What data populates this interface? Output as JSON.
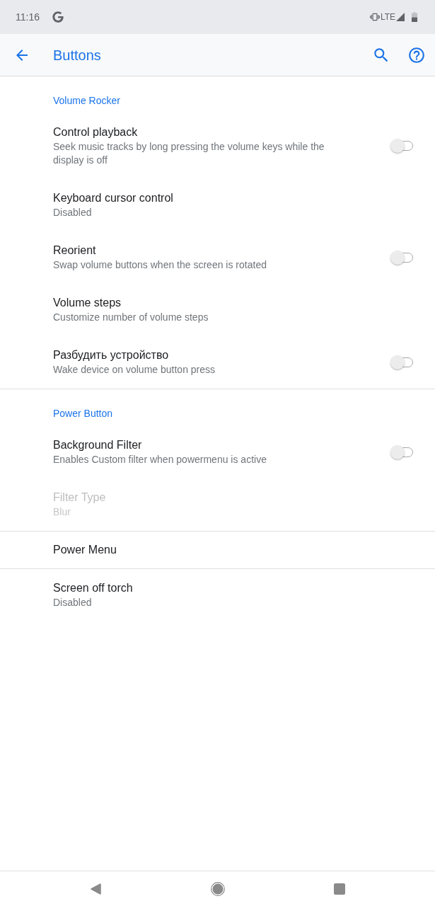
{
  "status_bar": {
    "time": "11:16",
    "network": "LTE"
  },
  "app_bar": {
    "title": "Buttons"
  },
  "sections": [
    {
      "title": "Volume Rocker",
      "items": [
        {
          "kind": "switch",
          "title": "Control playback",
          "summary": "Seek music tracks by long pressing the volume keys while the display is off",
          "on": false,
          "disabled": false
        },
        {
          "kind": "plain",
          "title": "Keyboard cursor control",
          "summary": "Disabled",
          "disabled": false
        },
        {
          "kind": "switch",
          "title": "Reorient",
          "summary": "Swap volume buttons when the screen is rotated",
          "on": false,
          "disabled": false
        },
        {
          "kind": "plain",
          "title": "Volume steps",
          "summary": "Customize number of volume steps",
          "disabled": false
        },
        {
          "kind": "switch",
          "title": "Разбудить устройство",
          "summary": "Wake device on volume button press",
          "on": false,
          "disabled": false
        }
      ]
    },
    {
      "title": "Power Button",
      "items": [
        {
          "kind": "switch",
          "title": "Background Filter",
          "summary": "Enables Custom filter when powermenu is active",
          "on": false,
          "disabled": false
        },
        {
          "kind": "plain",
          "title": "Filter Type",
          "summary": "Blur",
          "disabled": true
        }
      ]
    },
    {
      "items": [
        {
          "kind": "plain",
          "title": "Power Menu",
          "disabled": false
        }
      ]
    },
    {
      "items": [
        {
          "kind": "plain",
          "title": "Screen off torch",
          "summary": "Disabled",
          "disabled": false
        }
      ]
    }
  ]
}
